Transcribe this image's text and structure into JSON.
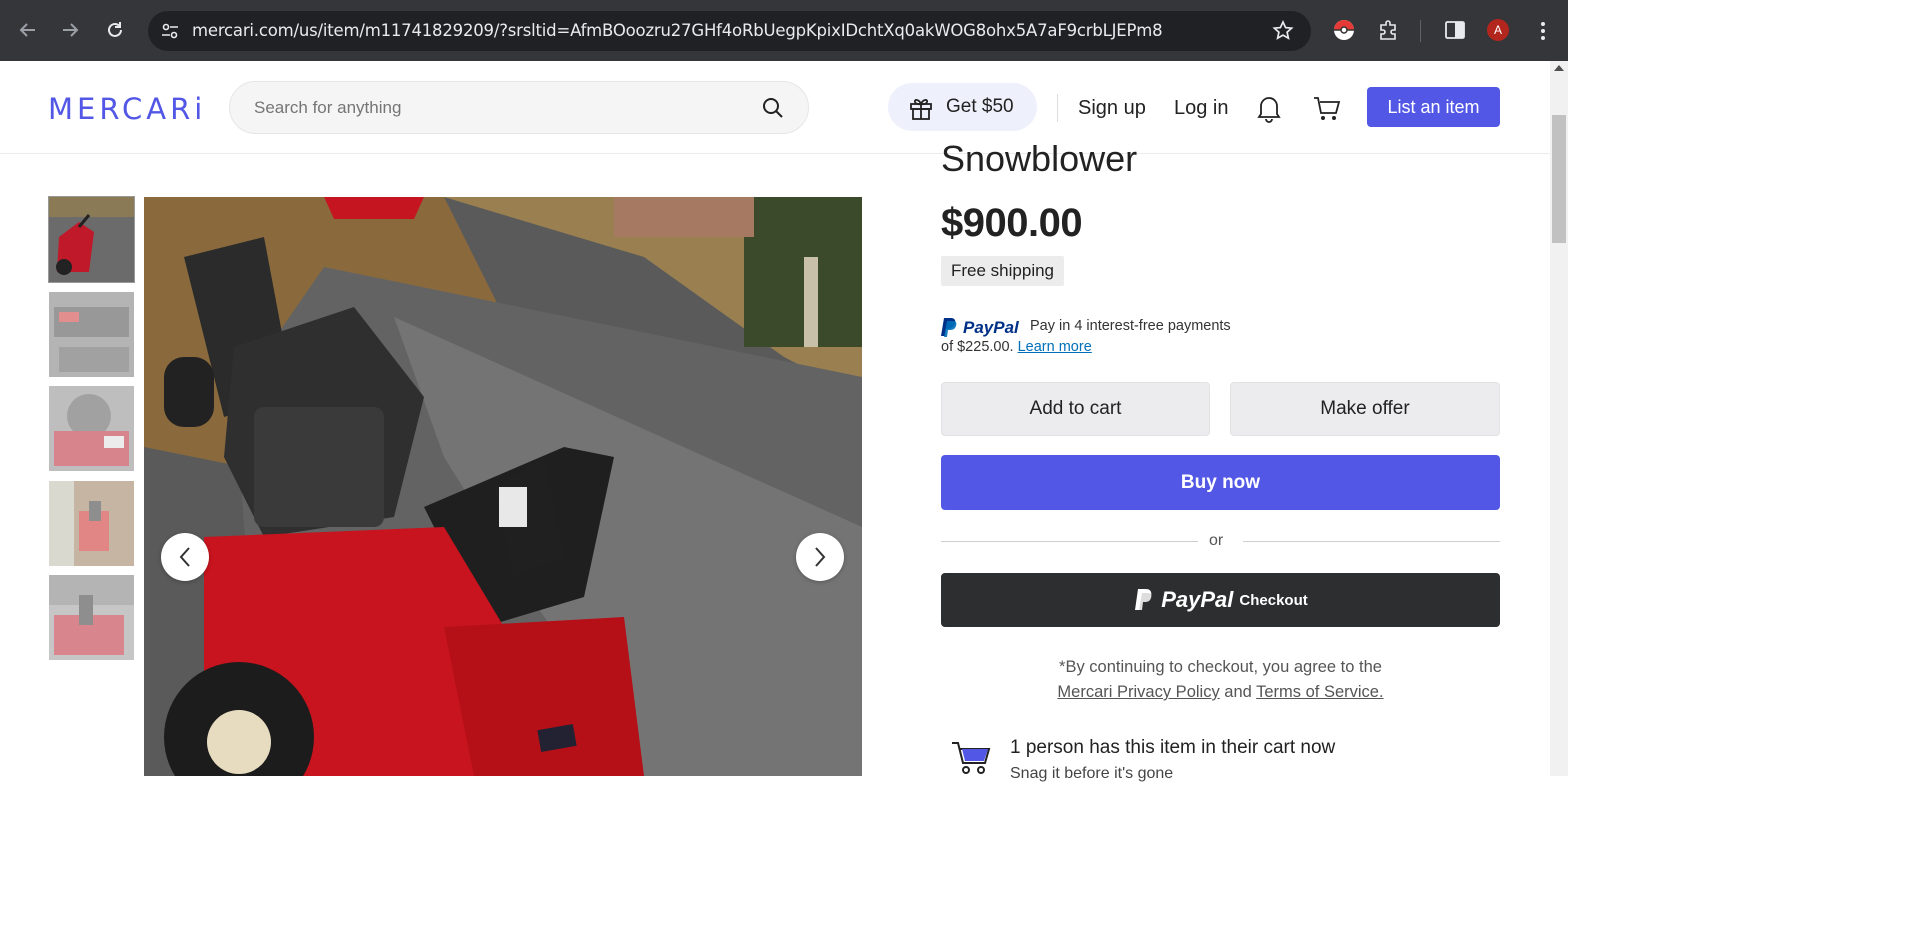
{
  "browser": {
    "url": "mercari.com/us/item/m11741829209/?srsltid=AfmBOoozru27GHf4oRbUegpKpixIDchtXq0akWOG8ohx5A7aF9crbLJEPm8",
    "profile_initial": "A"
  },
  "header": {
    "logo": "MERCARi",
    "search_placeholder": "Search for anything",
    "promo_label": "Get $50",
    "sign_up": "Sign up",
    "log_in": "Log in",
    "list_item": "List an item"
  },
  "gallery": {
    "thumbnail_count": 5,
    "selected_index": 0,
    "prev_icon": "chevron-left-icon",
    "next_icon": "chevron-right-icon"
  },
  "item": {
    "title": "Snowblower",
    "price": "$900.00",
    "shipping_badge": "Free shipping"
  },
  "paypal": {
    "logo_text": "PayPal",
    "line1": "Pay in 4 interest-free payments",
    "line2_prefix": "of $225.00.",
    "learn_more": "Learn more"
  },
  "actions": {
    "add_to_cart": "Add to cart",
    "make_offer": "Make offer",
    "buy_now": "Buy now",
    "or": "or",
    "paypal_checkout_brand": "PayPal",
    "paypal_checkout_label": "Checkout"
  },
  "terms": {
    "prefix": "*By continuing to checkout, you agree to the",
    "privacy_link": "Mercari Privacy Policy",
    "and": "and",
    "tos_link": "Terms of Service."
  },
  "cart_notice": {
    "headline": "1 person has this item in their cart now",
    "subtext": "Snag it before it's gone"
  },
  "colors": {
    "brand": "#5257e6",
    "paypal_blue": "#003087",
    "paypal_light": "#0070ba",
    "chrome_bg": "#35363a"
  }
}
